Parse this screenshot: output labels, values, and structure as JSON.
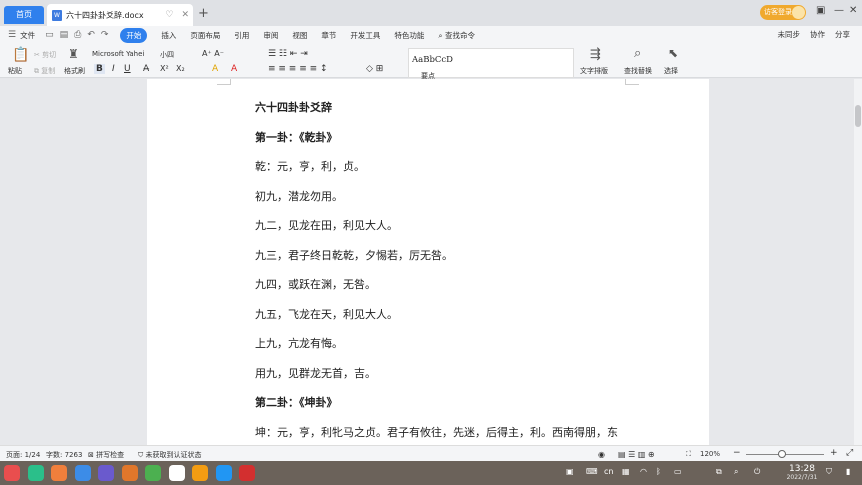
{
  "titlebar": {
    "home_tab": "首页",
    "doc_tab": "六十四卦卦爻辞.docx",
    "doc_icon": "W",
    "add_tab": "+",
    "login": "访客登录"
  },
  "menu": {
    "file": "文件",
    "items": [
      "开始",
      "插入",
      "页面布局",
      "引用",
      "审阅",
      "视图",
      "章节",
      "开发工具",
      "特色功能"
    ],
    "search": "查找命令",
    "right": [
      "未同步",
      "协作",
      "分享"
    ]
  },
  "ribbon": {
    "paste": "粘贴",
    "cut": "剪切",
    "copy": "复制",
    "format_painter": "格式刷",
    "font_name": "Microsoft Yahei",
    "font_size": "小四",
    "style_sample": "AaBbCcD",
    "style_name": "要点",
    "text_layout": "文字排版",
    "find_replace": "查找替换",
    "select": "选择"
  },
  "document": {
    "lines": [
      {
        "text": "六十四卦卦爻辞",
        "bold": true
      },
      {
        "text": "第一卦：《乾卦》",
        "bold": true
      },
      {
        "text": "乾：元，亨，利，贞。",
        "bold": false
      },
      {
        "text": "初九，潜龙勿用。",
        "bold": false
      },
      {
        "text": "九二，见龙在田，利见大人。",
        "bold": false
      },
      {
        "text": "九三，君子终日乾乾，夕惕若，厉无咎。",
        "bold": false
      },
      {
        "text": "九四，或跃在渊，无咎。",
        "bold": false
      },
      {
        "text": "九五，飞龙在天，利见大人。",
        "bold": false
      },
      {
        "text": "上九，亢龙有悔。",
        "bold": false
      },
      {
        "text": "用九，见群龙无首，吉。",
        "bold": false
      },
      {
        "text": "第二卦：《坤卦》",
        "bold": true
      },
      {
        "text": "坤：元，亨，利牝马之贞。君子有攸往，先迷，后得主，利。西南得朋，东",
        "bold": false
      }
    ]
  },
  "status": {
    "page": "页面: 1/24",
    "words": "字数: 7263",
    "spell": "拼写检查",
    "auth": "未获取到认证状态",
    "zoom": "120%",
    "zoom_level": 0.46
  },
  "taskbar": {
    "time": "13:28",
    "date": "2022/7/31",
    "ime": "cn",
    "app_colors": [
      "#e94e4e",
      "#2bbf8a",
      "#f07f3c",
      "#3c8ce7",
      "#6a5acd",
      "#e0772b",
      "#4cb050",
      "#ffffff",
      "#f39c12",
      "#2196f3",
      "#d32f2f"
    ]
  },
  "colors": {
    "accent": "#2f80ed",
    "login": "#f0a92e"
  }
}
